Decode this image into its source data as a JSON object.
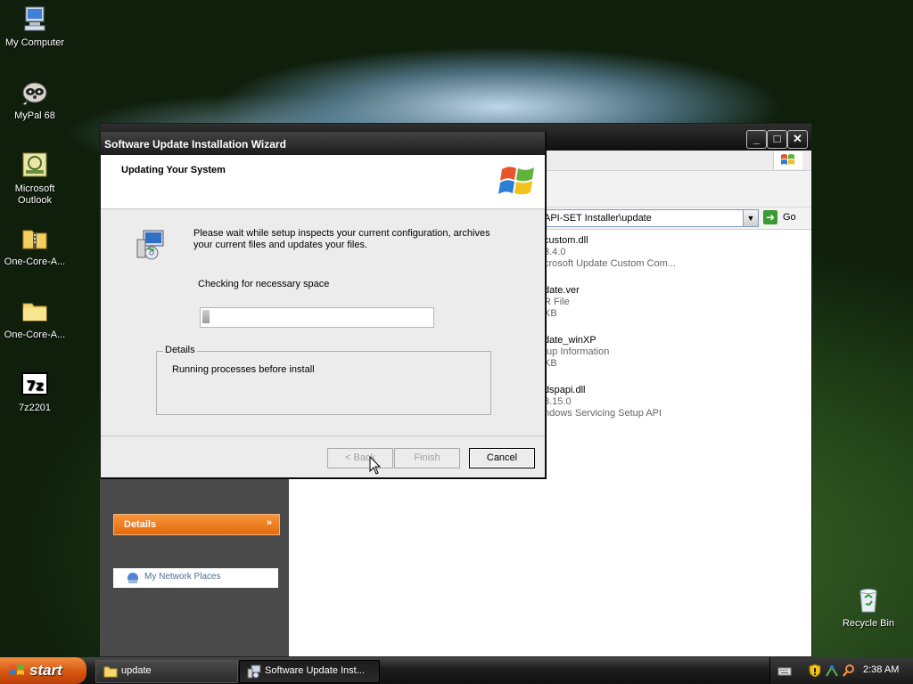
{
  "desktop": {
    "icons": [
      {
        "label": "My Computer",
        "icon": "my-computer-icon"
      },
      {
        "label": "MyPal 68",
        "icon": "mypal-raccoon-icon"
      },
      {
        "label": "Microsoft Outlook",
        "icon": "outlook-icon"
      },
      {
        "label": "One-Core-A...",
        "icon": "zip-folder-icon"
      },
      {
        "label": "One-Core-A...",
        "icon": "folder-icon"
      },
      {
        "label": "7z2201",
        "icon": "7zip-icon"
      },
      {
        "label": "Recycle Bin",
        "icon": "recycle-bin-icon"
      }
    ]
  },
  "explorer": {
    "address": "API-SET Installer\\update",
    "go_label": "Go",
    "left_pane": {
      "network_places": "My Network Places",
      "details_header": "Details"
    },
    "files": [
      {
        "name": "custom.dll",
        "line2": "3.4.0",
        "line3": "crosoft Update Custom Com..."
      },
      {
        "name": "date.ver",
        "line2": "R File",
        "line3": "KB"
      },
      {
        "name": "date_winXP",
        "line2": "tup Information",
        "line3": "KB"
      },
      {
        "name": "dspapi.dll",
        "line2": "3.15.0",
        "line3": "ndows Servicing Setup API"
      }
    ]
  },
  "wizard": {
    "title": "Software Update Installation Wizard",
    "heading": "Updating Your System",
    "message": "Please wait while setup inspects your current configuration, archives your current files and updates your files.",
    "status": "Checking for necessary space",
    "progress": 0.03,
    "details_legend": "Details",
    "details_value": "Running processes before install",
    "buttons": {
      "back": "< Back",
      "finish": "Finish",
      "cancel": "Cancel"
    }
  },
  "taskbar": {
    "start_label": "start",
    "tasks": [
      {
        "label": "update",
        "icon": "folder-icon"
      },
      {
        "label": "Software Update Inst...",
        "icon": "setup-icon"
      }
    ],
    "tray": {
      "time": "2:38 AM"
    }
  }
}
